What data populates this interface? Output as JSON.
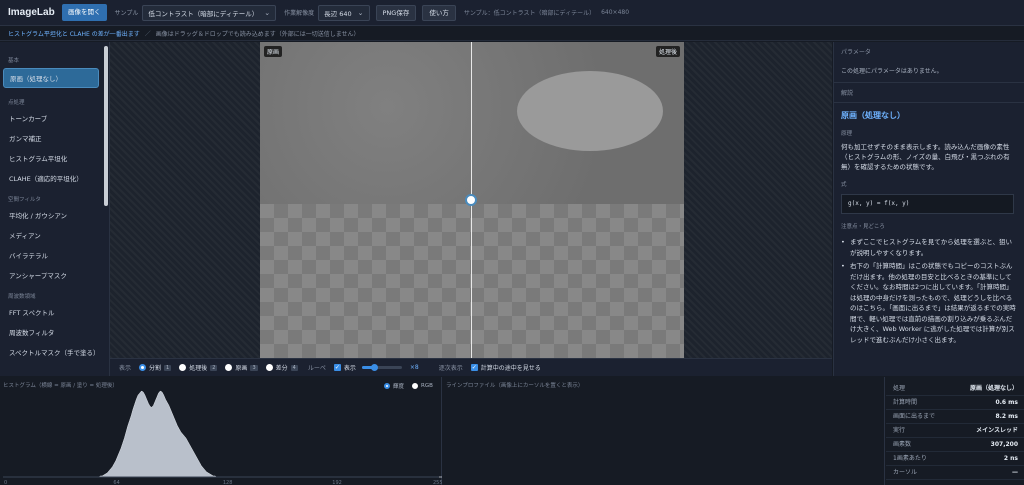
{
  "topbar": {
    "logo": "ImageLab",
    "open_button": "画像を開く",
    "sample_label": "サンプル",
    "sample_value": "低コントラスト（暗部にディテール）",
    "res_label": "作業解像度",
    "res_value": "長辺 640",
    "png_button": "PNG保存",
    "help_button": "使い方",
    "info_sample": "サンプル：低コントラスト（暗部にディテール）",
    "info_size": "640×480"
  },
  "subbar": {
    "link": "ヒストグラム平坦化と CLAHE の差が一番出ます",
    "sep": "／",
    "hint": "画像はドラッグ＆ドロップでも読み込めます（外部には一切送信しません）"
  },
  "sidebar": {
    "sections": [
      {
        "title": "基本",
        "items": [
          "原画（処理なし）"
        ]
      },
      {
        "title": "点処理",
        "items": [
          "トーンカーブ",
          "ガンマ補正",
          "ヒストグラム平坦化",
          "CLAHE（適応的平坦化）"
        ]
      },
      {
        "title": "空間フィルタ",
        "items": [
          "平均化 / ガウシアン",
          "メディアン",
          "バイラテラル",
          "アンシャープマスク"
        ]
      },
      {
        "title": "周波数領域",
        "items": [
          "FFT スペクトル",
          "周波数フィルタ",
          "スペクトルマスク（手で塗る）"
        ]
      }
    ]
  },
  "viewer": {
    "tag_left": "原画",
    "tag_right": "処理後"
  },
  "controls": {
    "display_label": "表示",
    "modes": [
      {
        "label": "分割",
        "key": "1"
      },
      {
        "label": "処理後",
        "key": "2"
      },
      {
        "label": "原画",
        "key": "3"
      },
      {
        "label": "差分",
        "key": "4"
      }
    ],
    "loupe_label": "ルーペ",
    "loupe_check": "表示",
    "zoom": "×8",
    "progressive_label": "逐次表示",
    "progressive_check": "計算中の途中を見せる",
    "loupe_zoom_fraction": 0.3
  },
  "rpanel": {
    "param_title": "パラメータ",
    "param_text": "この処理にパラメータはありません。",
    "explain_title": "解説",
    "algo_name": "原画（処理なし）",
    "principle_label": "原理",
    "principle": "何も加工せずそのまま表示します。読み込んだ画像の素性（ヒストグラムの形、ノイズの量、白飛び・黒つぶれの有無）を確認するための状態です。",
    "formula_label": "式",
    "formula": "g(x, y) = f(x, y)",
    "notes_label": "注意点・見どころ",
    "notes": [
      "まずここでヒストグラムを見てから処理を選ぶと、狙いが説明しやすくなります。",
      "右下の「計算時間」はこの状態でもコピーのコストぶんだけ出ます。他の処理の目安と比べるときの基準にしてください。なお時間は2つに出しています。「計算時間」は処理の中身だけを測ったもので、処理どうしを比べるのはこちら。「画面に出るまで」は結果が返るまでの実時間で、軽い処理では直前の描画の割り込みが乗るぶんだけ大きく、Web Worker に逃がした処理では計算が別スレッドで進むぶんだけ小さく出ます。"
    ]
  },
  "histogram": {
    "title": "ヒストグラム（横線 = 原画 / 塗り = 処理後）",
    "lum_label": "輝度",
    "rgb_label": "RGB",
    "ticks": [
      "0",
      "64",
      "128",
      "192",
      "255"
    ],
    "values": [
      0,
      0,
      0,
      0,
      0,
      0,
      0,
      0,
      0,
      0,
      0,
      0,
      0,
      0,
      0,
      0,
      0,
      0,
      0,
      0,
      0,
      0,
      0,
      0,
      0,
      0,
      0,
      0,
      0,
      0,
      0,
      0,
      0,
      0,
      0,
      0,
      0,
      0,
      0,
      0,
      0,
      0,
      0,
      0,
      0,
      0,
      0,
      0,
      0,
      0,
      0,
      0,
      0,
      0,
      0,
      0,
      0,
      1,
      1,
      2,
      3,
      4,
      6,
      8,
      10,
      13,
      16,
      20,
      24,
      28,
      33,
      38,
      44,
      50,
      55,
      60,
      66,
      71,
      76,
      80,
      82,
      84,
      83,
      80,
      76,
      72,
      69,
      68,
      70,
      74,
      78,
      82,
      84,
      83,
      80,
      76,
      73,
      70,
      66,
      62,
      58,
      54,
      50,
      47,
      44,
      42,
      40,
      38,
      35,
      32,
      29,
      26,
      23,
      20,
      17,
      14,
      11,
      9,
      7,
      5,
      4,
      3,
      2,
      1,
      1,
      0,
      0,
      0,
      0,
      0,
      0,
      0,
      0,
      0,
      0,
      0,
      0,
      0,
      0,
      0,
      0,
      0,
      0,
      0,
      0,
      0,
      0,
      0,
      0,
      0,
      0,
      0,
      0,
      0,
      0,
      0,
      0,
      0,
      0,
      0,
      0,
      0,
      0,
      0,
      0,
      0,
      0,
      0,
      0,
      0,
      0,
      0,
      0,
      0,
      0,
      0,
      0,
      0,
      0,
      0,
      0,
      0,
      0,
      0,
      0,
      0,
      0,
      0,
      0,
      0,
      0,
      0,
      0,
      0,
      0,
      0,
      0,
      0,
      0,
      0,
      0,
      0,
      0,
      0,
      0,
      0,
      0,
      0,
      0,
      0,
      0,
      0,
      0,
      0,
      0,
      0,
      0,
      0,
      0,
      0,
      0,
      0,
      0,
      0,
      0,
      0,
      0,
      0,
      0,
      0,
      0,
      0,
      0,
      0,
      0,
      0,
      0,
      0,
      0,
      0,
      0,
      0,
      0,
      0,
      0,
      0,
      0,
      0,
      0,
      0,
      0,
      0,
      0,
      0,
      0,
      0,
      0,
      0,
      0,
      0,
      0,
      0,
      0,
      0,
      0,
      0,
      0,
      0,
      0,
      0,
      0,
      0,
      0
    ]
  },
  "profile": {
    "title": "ラインプロファイル（画像上にカーソルを置くと表示）"
  },
  "stats": [
    {
      "k": "処理",
      "v": "原画（処理なし）"
    },
    {
      "k": "計算時間",
      "v": "0.6 ms"
    },
    {
      "k": "画面に出るまで",
      "v": "8.2 ms"
    },
    {
      "k": "実行",
      "v": "メインスレッド"
    },
    {
      "k": "画素数",
      "v": "307,200"
    },
    {
      "k": "1画素あたり",
      "v": "2 ns"
    },
    {
      "k": "カーソル",
      "v": "—"
    }
  ]
}
